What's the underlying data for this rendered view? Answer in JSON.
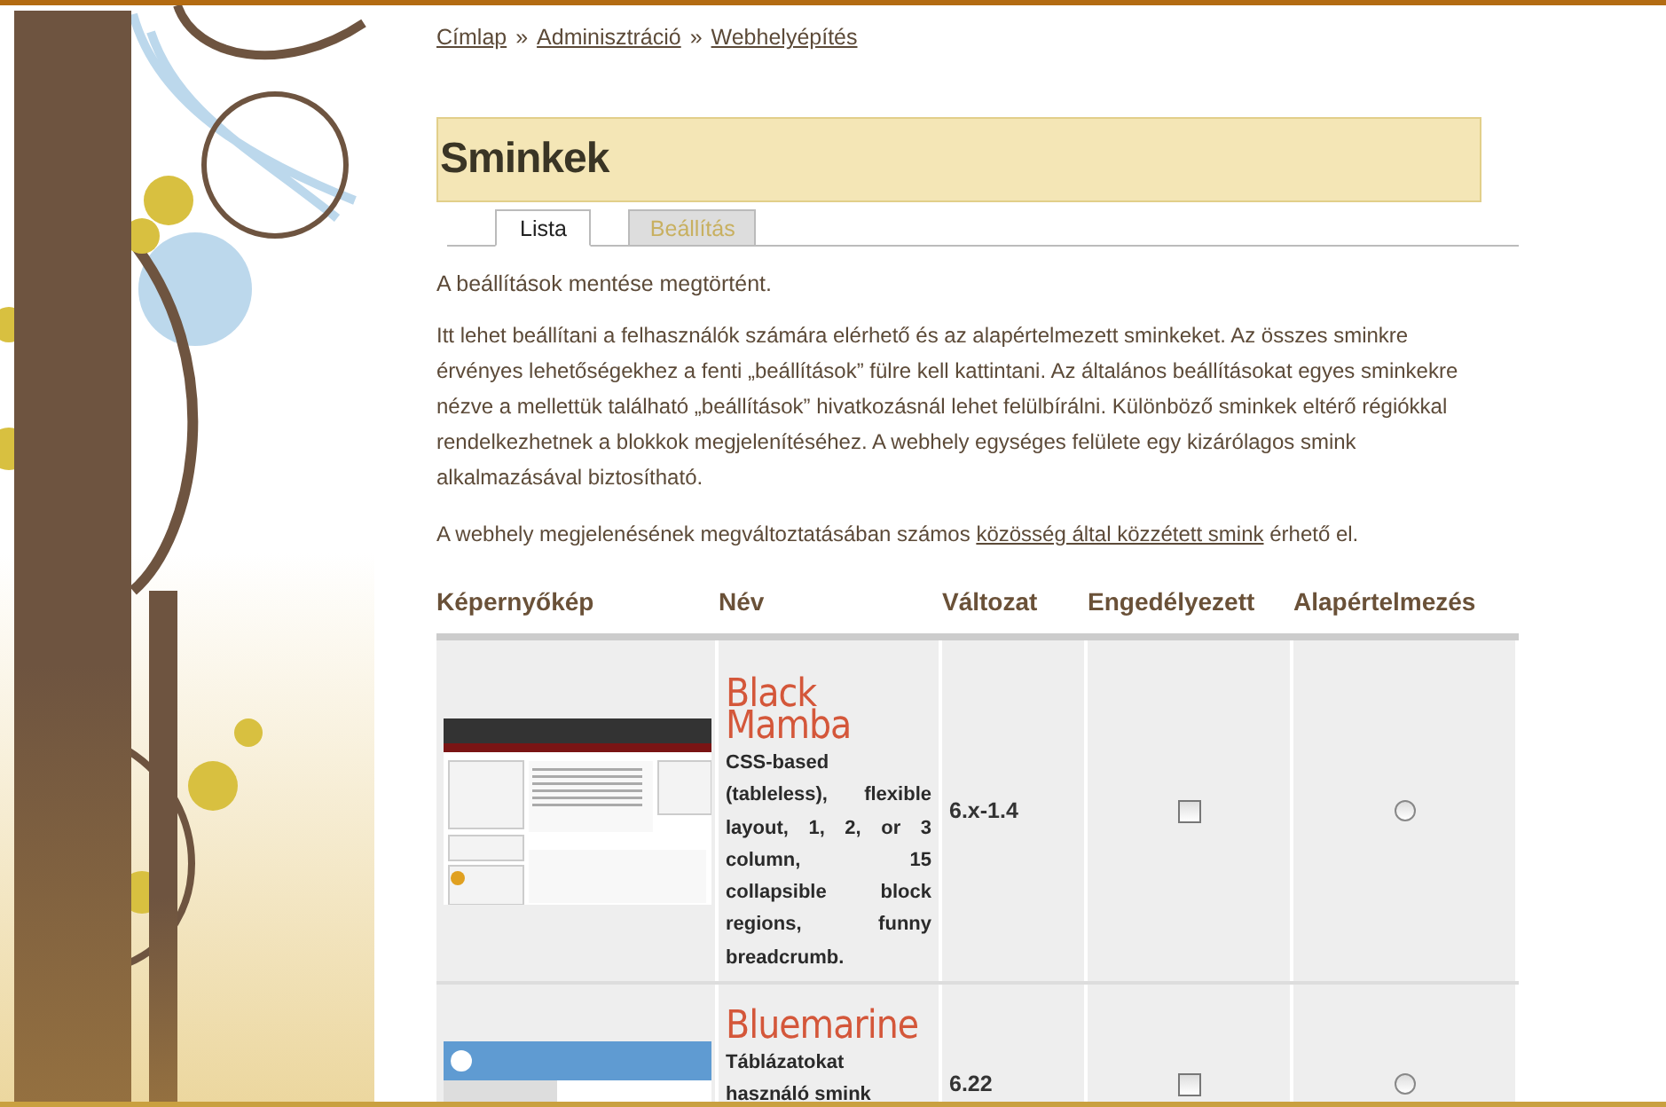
{
  "breadcrumb": [
    {
      "kind": "link",
      "text": "Címlap"
    },
    {
      "kind": "separator",
      "text": "»"
    },
    {
      "kind": "link",
      "text": "Adminisztráció"
    },
    {
      "kind": "separator",
      "text": "»"
    },
    {
      "kind": "link",
      "text": "Webhelyépítés"
    }
  ],
  "title": "Sminkek",
  "tabs": [
    {
      "label": "Lista",
      "selected": true
    },
    {
      "label": "Beállítás",
      "selected": false
    }
  ],
  "status_message": "A beállítások mentése megtörtént.",
  "description": "Itt lehet beállítani a felhasználók számára elérhető és az alapértelmezett sminkeket. Az összes sminkre érvényes lehetőségekhez a fenti „beállítások” fülre kell kattintani. Az általános beállításokat egyes sminkekre nézve a mellettük található „beállítások” hivatkozásnál lehet felülbírálni. Különböző sminkek eltérő régiókkal rendelkezhetnek a blokkok megjelenítéséhez. A webhely egységes felülete egy kizárólagos smink alkalmazásával biztosítható.",
  "community_note": {
    "before": "A webhely megjelenésének megváltoztatásában számos ",
    "link": "közösség által közzétett smink",
    "after": " érhető el."
  },
  "table": {
    "columns": [
      "Képernyőkép",
      "Név",
      "Változat",
      "Engedélyezett",
      "Alapértelmezés"
    ],
    "rows": [
      {
        "kind": "dark",
        "name": "Black Mamba",
        "description": "CSS-based (tableless), flexible layout, 1, 2, or 3 column, 15 collapsible block regions, funny breadcrumb.",
        "version": "6.x-1.4",
        "enabled": false,
        "default": false
      },
      {
        "kind": "blue",
        "name": "Bluemarine",
        "description": "Táblázatokat használó smink",
        "version": "6.22",
        "enabled": false,
        "default": false
      }
    ]
  }
}
